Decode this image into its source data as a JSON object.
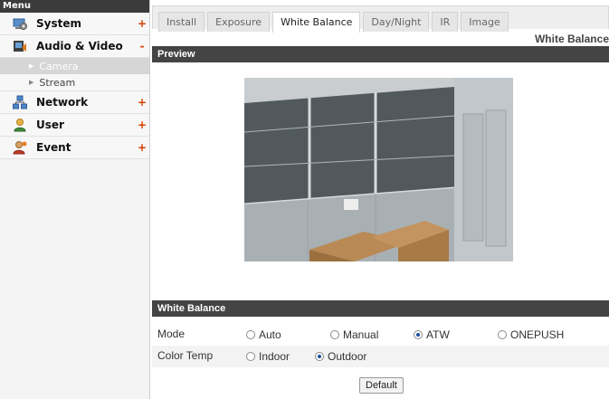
{
  "sidebar": {
    "header": "Menu",
    "items": [
      {
        "label": "System",
        "toggle": "+",
        "icon": "system-icon"
      },
      {
        "label": "Audio & Video",
        "toggle": "-",
        "icon": "audio-video-icon",
        "children": [
          {
            "label": "Camera",
            "active": true
          },
          {
            "label": "Stream",
            "active": false
          }
        ]
      },
      {
        "label": "Network",
        "toggle": "+",
        "icon": "network-icon"
      },
      {
        "label": "User",
        "toggle": "+",
        "icon": "user-icon"
      },
      {
        "label": "Event",
        "toggle": "+",
        "icon": "event-icon"
      }
    ]
  },
  "tabs": [
    "Install",
    "Exposure",
    "White Balance",
    "Day/Night",
    "IR",
    "Image"
  ],
  "active_tab": "White Balance",
  "page_title": "White Balance",
  "preview": {
    "header": "Preview"
  },
  "white_balance": {
    "header": "White Balance",
    "mode": {
      "label": "Mode",
      "options": [
        "Auto",
        "Manual",
        "ATW",
        "ONEPUSH"
      ],
      "selected": "ATW"
    },
    "color_temp": {
      "label": "Color Temp",
      "options": [
        "Indoor",
        "Outdoor"
      ],
      "selected": "Outdoor"
    }
  },
  "default_button": "Default",
  "colors": {
    "accent_toggle": "#d44000",
    "section_bar": "#444444",
    "radio_selected": "#1a4e9a"
  }
}
